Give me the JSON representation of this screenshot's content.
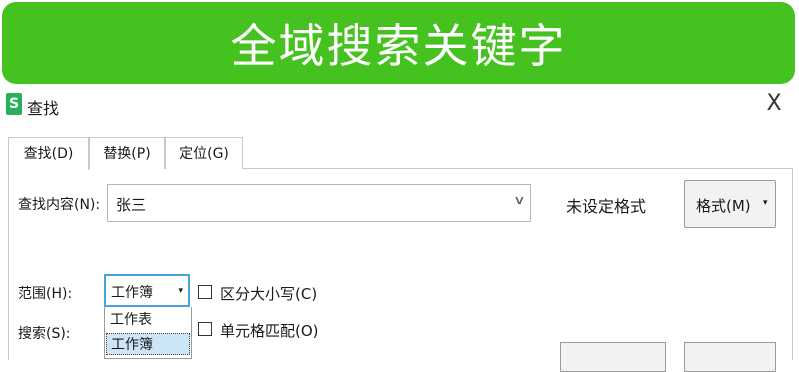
{
  "banner": {
    "title": "全域搜索关键字"
  },
  "dialog": {
    "icon_letter": "S",
    "title": "查找",
    "close_glyph": "X",
    "tabs": [
      {
        "label": "查找(D)",
        "active": true
      },
      {
        "label": "替换(P)",
        "active": false
      },
      {
        "label": "定位(G)",
        "active": false
      }
    ],
    "find": {
      "label": "查找内容(N):",
      "value": "张三",
      "chevron": "∨",
      "format_status": "未设定格式",
      "format_button": "格式(M)",
      "format_dropdown_glyph": "▾"
    },
    "scope": {
      "label": "范围(H):",
      "selected": "工作簿",
      "arrow": "▾",
      "options": [
        "工作表",
        "工作簿"
      ]
    },
    "search": {
      "label": "搜索(S):"
    },
    "checkboxes": [
      {
        "label": "区分大小写(C)",
        "checked": false
      },
      {
        "label": "单元格匹配(O)",
        "checked": false
      }
    ]
  },
  "colors": {
    "banner_green": "#45c21f",
    "app_icon_green": "#28b15a",
    "select_border": "#49a3d8",
    "selected_item_bg": "#cde6f7"
  }
}
